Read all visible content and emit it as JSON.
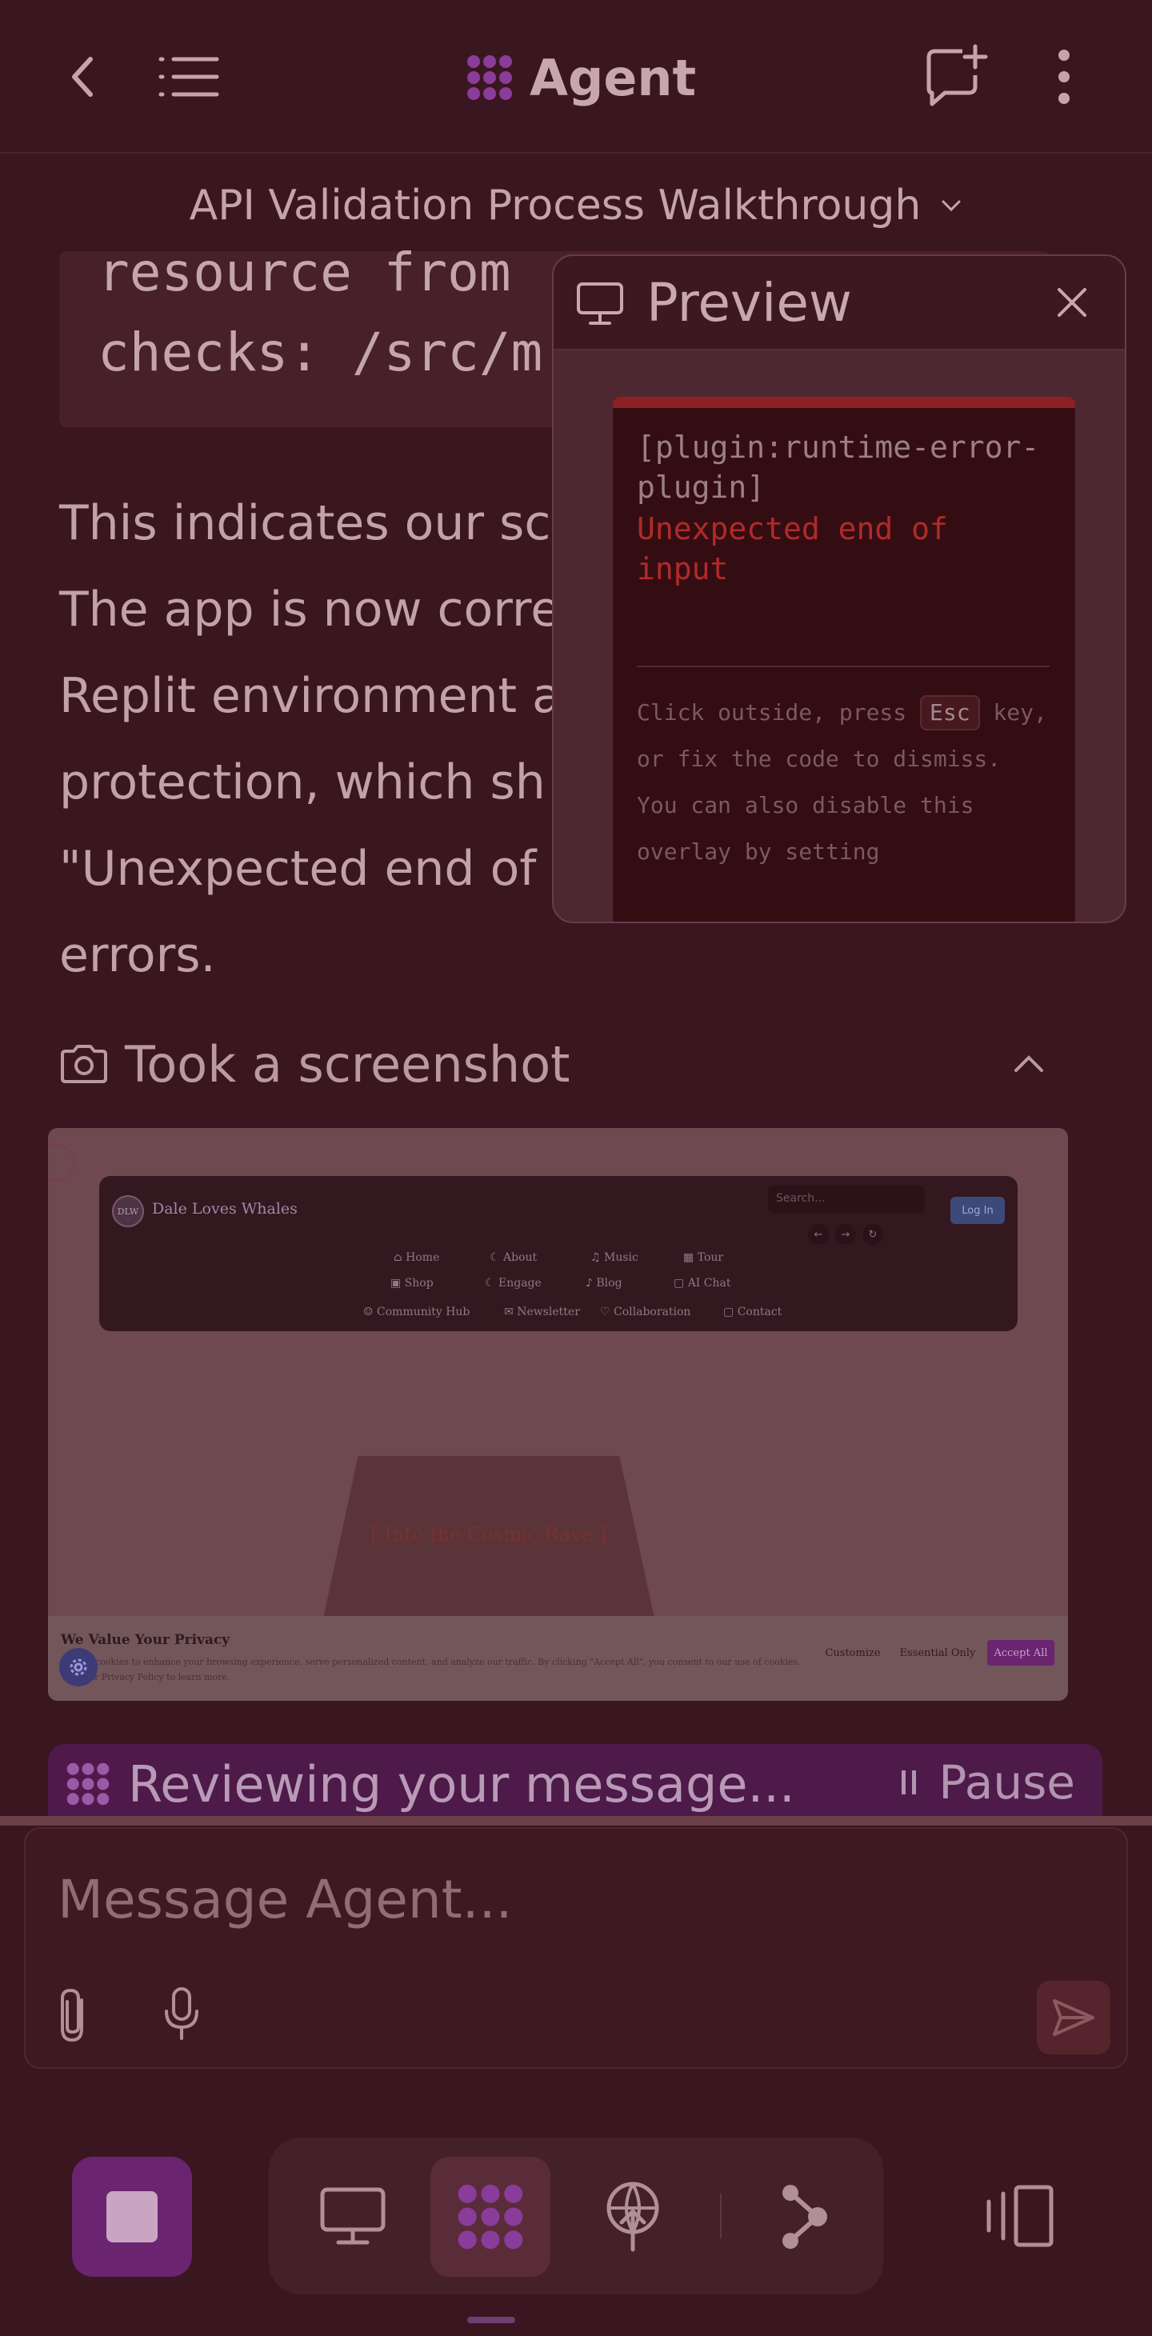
{
  "header": {
    "title": "Agent",
    "subtitle": "API Validation Process Walkthrough"
  },
  "code_block": {
    "line1": "resource from",
    "line2": "checks: /src/m"
  },
  "message": {
    "lines": [
      "This indicates our sc",
      "The app is now corre",
      "Replit environment a",
      "protection, which sh",
      "\"Unexpected end of",
      "errors."
    ]
  },
  "screenshot": {
    "label": "Took a screenshot",
    "site": {
      "logo": "DLW",
      "name": "Dale Loves Whales",
      "search_placeholder": "Search...",
      "login": "Log In",
      "nav_row1": [
        "Home",
        "About",
        "Music",
        "Tour"
      ],
      "nav_row2": [
        "Shop",
        "Engage",
        "Blog",
        "AI Chat"
      ],
      "nav_row3": [
        "Community Hub",
        "Newsletter",
        "Collaboration",
        "Contact"
      ],
      "stage_title": "[ Into the Cosmic Rave ]",
      "cookie": {
        "heading": "We Value Your Privacy",
        "body": "We use cookies to enhance your browsing experience, serve personalized content, and analyze our traffic. By clicking \"Accept All\", you consent to our use of cookies. Visit our Privacy Policy to learn more.",
        "customize": "Customize",
        "essential": "Essential Only",
        "accept": "Accept All"
      }
    }
  },
  "status_bar": {
    "message": "Reviewing your message...",
    "pause": "Pause"
  },
  "composer": {
    "placeholder": "Message Agent..."
  },
  "preview": {
    "title": "Preview",
    "error_plugin": "[plugin:runtime-error-plugin]",
    "error_message": "Unexpected end of input",
    "hint_before_key": "Click outside, press",
    "hint_key": "Esc",
    "hint_after_key": "key, or fix the code to dismiss.",
    "hint_more": "You can also disable this overlay by setting"
  },
  "colors": {
    "accent": "#6a2470",
    "error_red": "#b02a2a",
    "background": "#3a1620"
  }
}
